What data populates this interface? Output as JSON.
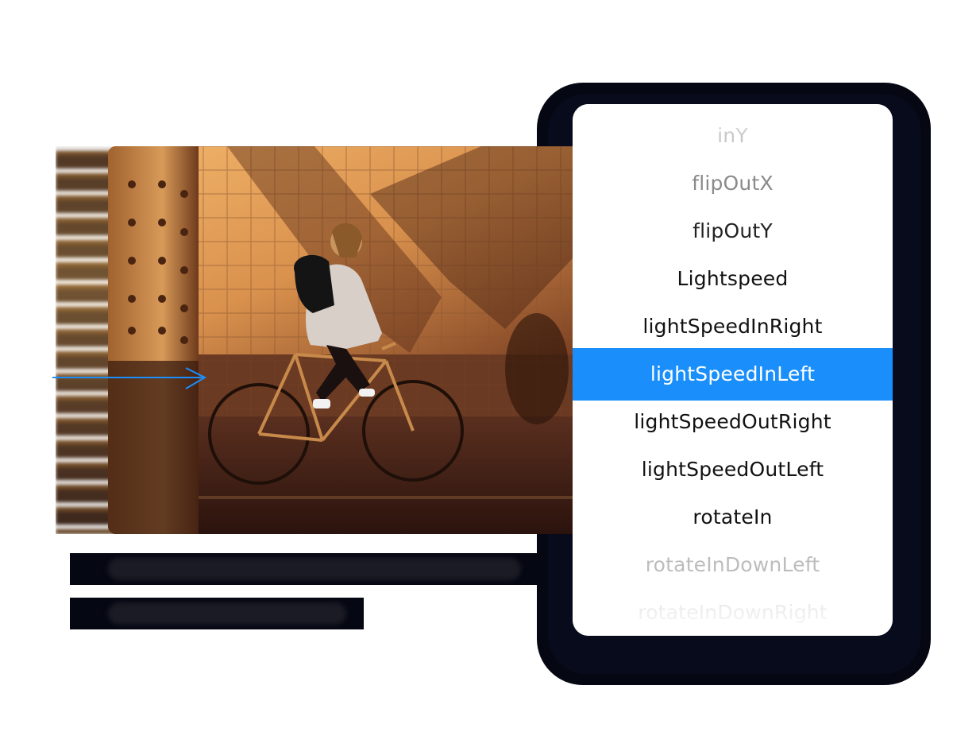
{
  "animation_list": {
    "items": [
      {
        "label": "inY",
        "state": "faded"
      },
      {
        "label": "flipOutX",
        "state": "dim"
      },
      {
        "label": "flipOutY",
        "state": "normal"
      },
      {
        "label": "Lightspeed",
        "state": "normal"
      },
      {
        "label": "lightSpeedInRight",
        "state": "normal"
      },
      {
        "label": "lightSpeedInLeft",
        "state": "selected"
      },
      {
        "label": "lightSpeedOutRight",
        "state": "normal"
      },
      {
        "label": "lightSpeedOutLeft",
        "state": "normal"
      },
      {
        "label": "rotateIn",
        "state": "normal"
      },
      {
        "label": "rotateInDownLeft",
        "state": "dim"
      },
      {
        "label": "rotateInDownRight",
        "state": "faded"
      }
    ],
    "selected_index": 5,
    "accent_color": "#1a8ffb"
  },
  "colors": {
    "backdrop": "#050713",
    "panel": "#ffffff",
    "arrow": "#1a8ffb"
  }
}
